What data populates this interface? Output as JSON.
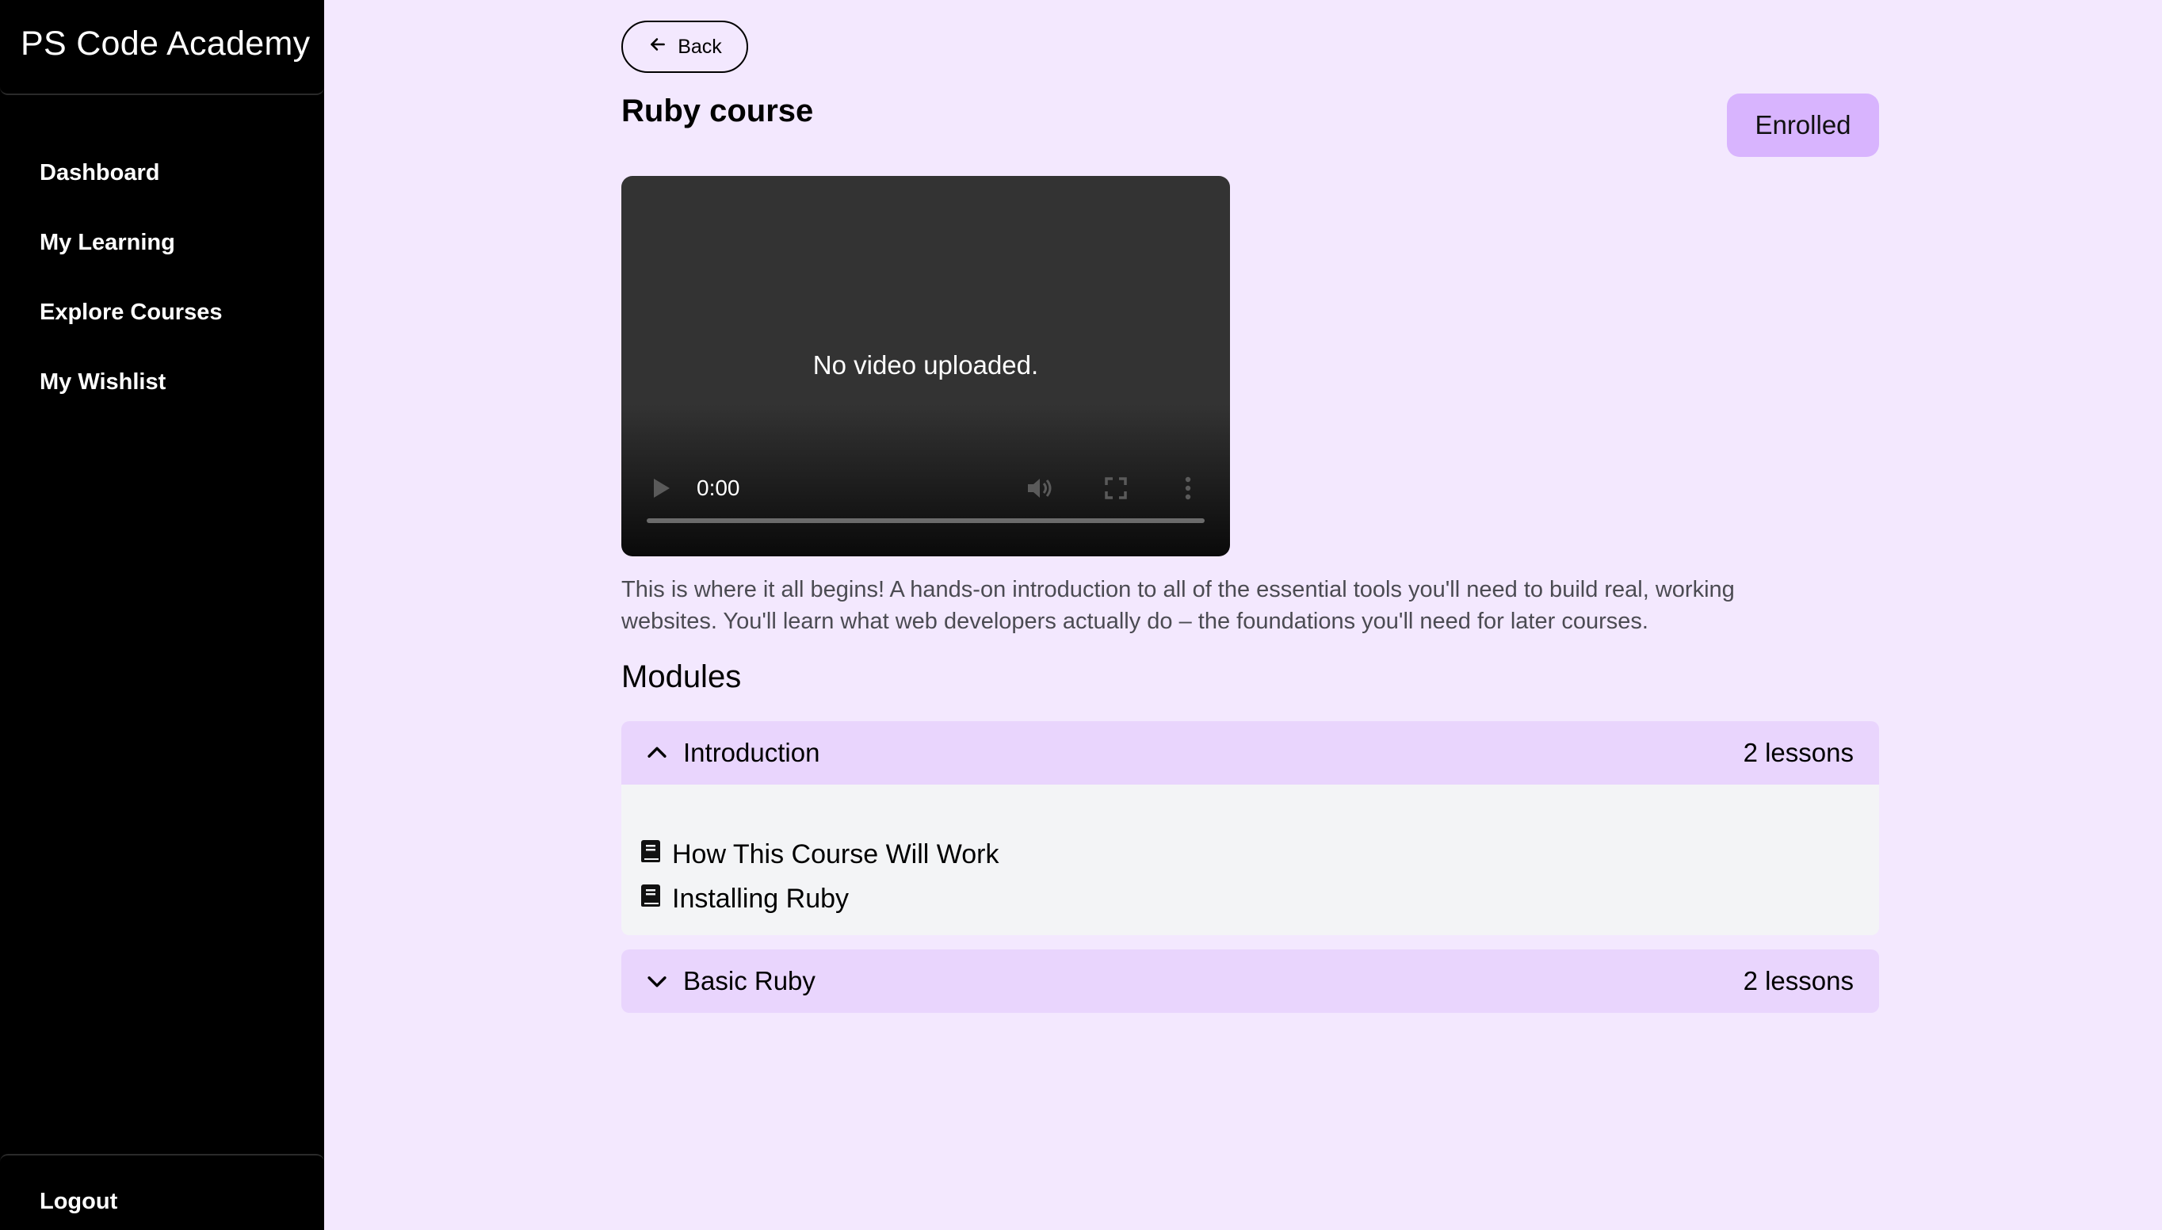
{
  "sidebar": {
    "brand": "PS Code Academy",
    "items": [
      {
        "label": "Dashboard"
      },
      {
        "label": "My Learning"
      },
      {
        "label": "Explore Courses"
      },
      {
        "label": "My Wishlist"
      }
    ],
    "logout_label": "Logout"
  },
  "header": {
    "back_label": "Back",
    "title": "Ruby course",
    "status": "Enrolled"
  },
  "video": {
    "message": "No video uploaded.",
    "time": "0:00"
  },
  "course": {
    "description": "This is where it all begins! A hands-on introduction to all of the essential tools you'll need to build real, working websites. You'll learn what web developers actually do – the foundations you'll need for later courses."
  },
  "modules": {
    "heading": "Modules",
    "items": [
      {
        "title": "Introduction",
        "count": "2 lessons",
        "expanded": true,
        "lessons": [
          {
            "title": "How This Course Will Work"
          },
          {
            "title": "Installing Ruby"
          }
        ]
      },
      {
        "title": "Basic Ruby",
        "count": "2 lessons",
        "expanded": false
      }
    ]
  },
  "colors": {
    "background": "#f3e8fe",
    "sidebar": "#000000",
    "badge": "#d8b4fe",
    "module_header": "#e9d5fd",
    "lessons_panel": "#f3f4f6"
  },
  "icons": {
    "back": "arrow-left-icon",
    "expanded": "chevron-up-icon",
    "collapsed": "chevron-down-icon",
    "lesson": "book-icon",
    "play": "play-icon",
    "mute": "volume-icon",
    "fullscreen": "fullscreen-icon",
    "more": "more-vertical-icon"
  }
}
